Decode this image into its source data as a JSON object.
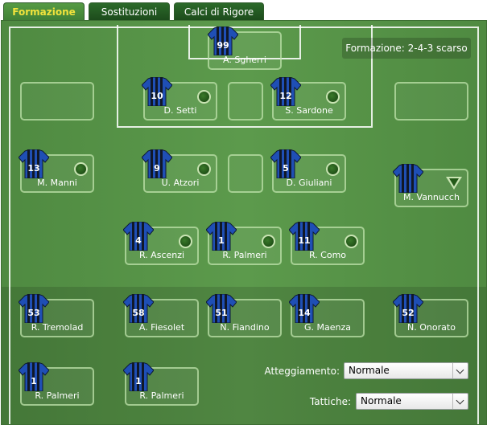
{
  "tabs": [
    {
      "label": "Formazione",
      "active": true
    },
    {
      "label": "Sostituzioni",
      "active": false
    },
    {
      "label": "Calci di Rigore",
      "active": false
    }
  ],
  "formation": {
    "label": "Formazione: 2-4-3 scarso"
  },
  "players": {
    "gk": {
      "number": "99",
      "name": "A. Sgherri"
    },
    "def_l": {
      "number": "10",
      "name": "D. Setti"
    },
    "def_r": {
      "number": "12",
      "name": "S. Sardone"
    },
    "mid_1": {
      "number": "13",
      "name": "M. Manni"
    },
    "mid_2": {
      "number": "9",
      "name": "U. Atzori"
    },
    "mid_3": {
      "number": "5",
      "name": "D. Giuliani"
    },
    "mid_4": {
      "number": "",
      "name": "M. Vannucch"
    },
    "fw_1": {
      "number": "4",
      "name": "R. Ascenzi"
    },
    "fw_2": {
      "number": "1",
      "name": "R. Palmeri"
    },
    "fw_3": {
      "number": "11",
      "name": "R. Como"
    }
  },
  "bench": {
    "b1": {
      "number": "53",
      "name": "R. Tremolad"
    },
    "b2": {
      "number": "58",
      "name": "A. Fiesolet"
    },
    "b3": {
      "number": "51",
      "name": "N. Fiandino"
    },
    "b4": {
      "number": "14",
      "name": "G. Maenza"
    },
    "b5": {
      "number": "52",
      "name": "N. Onorato"
    },
    "b6": {
      "number": "1",
      "name": "R. Palmeri"
    },
    "b7": {
      "number": "1",
      "name": "R. Palmeri"
    }
  },
  "controls": {
    "attitude_label": "Atteggiamento:",
    "attitude_value": "Normale",
    "tactics_label": "Tattiche:",
    "tactics_value": "Normale"
  },
  "colors": {
    "jersey_blue": "#1f4fb5",
    "jersey_black": "#101828",
    "pitch": "#5c9a4c"
  }
}
